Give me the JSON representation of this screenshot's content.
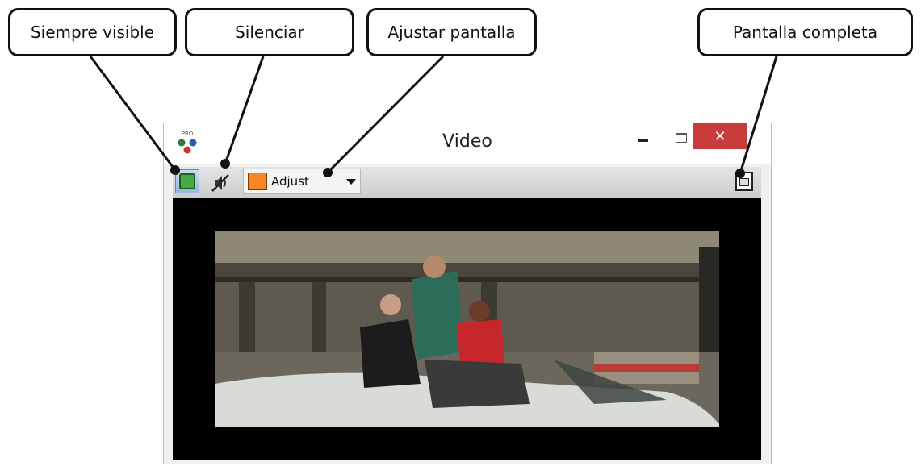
{
  "callouts": {
    "pin": "Siempre visible",
    "mute": "Silenciar",
    "fit": "Ajustar pantalla",
    "fullscreen": "Pantalla completa"
  },
  "window": {
    "title": "Video",
    "logo_text": "PRO",
    "close_glyph": "✕"
  },
  "toolbar": {
    "adjust_label": "Adjust",
    "adjust_color": "#fb8423"
  },
  "colors": {
    "close_button": "#c93c3c",
    "pin_icon": "#48a848"
  },
  "icons": [
    "app-logo-icon",
    "pin-icon",
    "mute-icon",
    "adjust-color-icon",
    "dropdown-arrow-icon",
    "fullscreen-icon"
  ]
}
